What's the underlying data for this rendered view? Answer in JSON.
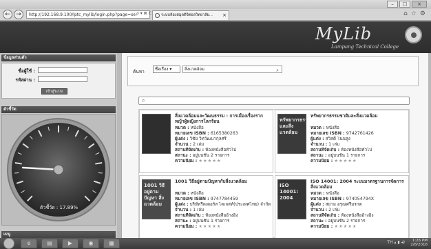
{
  "browser": {
    "address": "http://192.168.9.100/lptc_mylib/login.php?page=se",
    "address_tools": "ρ ▾ ⊠ C",
    "tab_title": "ระบบห้องสมุดดิจิตอลวิทยาลัย...",
    "tab_close": "×",
    "back": "←",
    "forward": "→",
    "win_minimize": "–",
    "win_maximize": "□",
    "win_close": "×",
    "nav_icons": [
      "⌂",
      "☆",
      "⚙"
    ]
  },
  "header": {
    "logo": "MyLib",
    "subtitle": "Lampang Technical College"
  },
  "sidebar": {
    "member_header": "ข้อมูลส่วนตัว",
    "username_label": "ชื่อผู้ใช้ :",
    "password_label": "รหัสผ่าน :",
    "login_button": "เข้าสู่ระบบ",
    "index_header": "ตัวชี้วัด",
    "gauge_label": "ตัวชี้วัด : 17.89%",
    "gauge_value": 17.89,
    "menu_header": "เมนู"
  },
  "search": {
    "label": "ค้นหา",
    "field_select": "ชื่อเรื่อง ▾",
    "query": "สิ่งแวดล้อม",
    "filter_placeholder": ""
  },
  "books": [
    {
      "title": "สิ่งแวดล้อมและวัฒนธรรม : การเมืองเรื่องรากหญ้าผู้หญิงการโลกร้อน",
      "type_label": "หมวด :",
      "type": "หนังสือ",
      "isbn_label": "หมายเลข ISBN :",
      "isbn": "6165380263",
      "author_label": "ผู้แต่ง :",
      "author": "วิชัย วิทวัฒนากุลศรี",
      "count_label": "จำนวน :",
      "count": "2 เล่ม",
      "location_label": "สถานที่จัดเก็บ :",
      "location": "ห้องหนังสือทั่วไป",
      "status_label": "สถานะ :",
      "status": "อยู่บนชั้น 2 รายการ",
      "rating_label": "ความนิยม :",
      "rating": "★★★★★",
      "cover_color": "#2e2e2e",
      "cover_text": ""
    },
    {
      "title": "ทรัพยากรธรรมชาติและสิ่งแวดล้อม",
      "type_label": "หมวด :",
      "type": "หนังสือ",
      "isbn_label": "หมายเลข ISBN :",
      "isbn": "9742761426",
      "author_label": "ผู้แต่ง :",
      "author": "สวิสดี้ โนนสูง",
      "count_label": "จำนวน :",
      "count": "1 เล่ม",
      "location_label": "สถานที่จัดเก็บ :",
      "location": "ห้องหนังสือทั่วไป",
      "status_label": "สถานะ :",
      "status": "อยู่บนชั้น 1 รายการ",
      "rating_label": "ความนิยม :",
      "rating": "★★★★★",
      "cover_color": "#3a3a3a",
      "cover_text": "ทรัพยากรธรรมชาติและสิ่งแวดล้อม"
    },
    {
      "title": "1001 วิธีอยู่ตามปัญหากับสิ่งแวดล้อม",
      "type_label": "หมวด :",
      "type": "หนังสือ",
      "isbn_label": "หมายเลข ISBN :",
      "isbn": "9747784459",
      "author_label": "ผู้แต่ง :",
      "author": "บริษัทรีดเดอร์ส ไดเจสท์(ประเทศไทย) จำกัด",
      "count_label": "จำนวน :",
      "count": "1 เล่ม",
      "location_label": "สถานที่จัดเก็บ :",
      "location": "ห้องหนังสืออ้างอิง",
      "status_label": "สถานะ :",
      "status": "อยู่บนชั้น 1 รายการ",
      "rating_label": "ความนิยม :",
      "rating": "★★★★★",
      "cover_color": "#4a4a4a",
      "cover_text": "1001 วิธีอยู่ตามปัญหา สิ่งแวดล้อม"
    },
    {
      "title": "ISO 14001: 2004 ระบบมาตรฐานการจัดการสิ่งแวดล้อม",
      "type_label": "หมวด :",
      "type": "หนังสือ",
      "isbn_label": "หมายเลข ISBN :",
      "isbn": "974054794X",
      "author_label": "ผู้แต่ง :",
      "author": "สยาม อรุณศรีมรกต",
      "count_label": "จำนวน :",
      "count": "2 เล่ม",
      "location_label": "สถานที่จัดเก็บ :",
      "location": "ห้องหนังสืออ้างอิง",
      "status_label": "สถานะ :",
      "status": "อยู่บนชั้น 2 รายการ",
      "rating_label": "ความนิยม :",
      "rating": "★★★★★",
      "cover_color": "#353535",
      "cover_text": "ISO 14001: 2004"
    }
  ],
  "taskbar": {
    "apps": [
      "e",
      "▤",
      "▶",
      "◉",
      "▦"
    ],
    "tray": "TH ▴ ▮ ◂)",
    "time": "1:26 PM",
    "date": "2/8/2016"
  }
}
